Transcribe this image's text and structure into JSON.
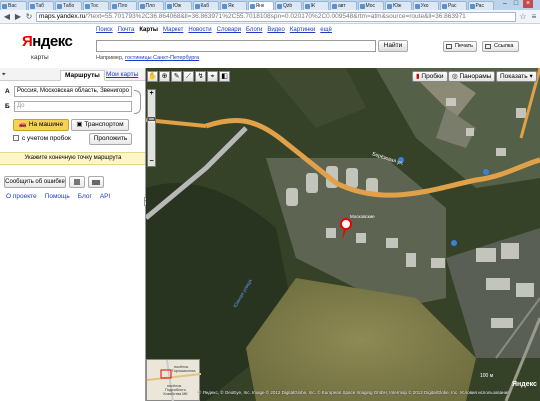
{
  "browser": {
    "tabs": [
      {
        "label": "Вас"
      },
      {
        "label": "Таб"
      },
      {
        "label": "Табо"
      },
      {
        "label": "Тос"
      },
      {
        "label": "Пло"
      },
      {
        "label": "Пло"
      },
      {
        "label": "Юж"
      },
      {
        "label": "Каб"
      },
      {
        "label": "Як"
      },
      {
        "label": "Янк"
      },
      {
        "label": "Qzb"
      },
      {
        "label": "Ж"
      },
      {
        "label": "авт"
      },
      {
        "label": "Мос"
      },
      {
        "label": "Юж"
      },
      {
        "label": "Уко"
      },
      {
        "label": "Рас"
      },
      {
        "label": "Рас"
      }
    ],
    "url_domain": "maps.yandex.ru",
    "url_rest": "/?text=55.701793%2C36.864068&ll=36.863971%2C55.7018108spn=0.020170%2C0.009548&rtm=atm&source=route&ll=36.863971"
  },
  "header": {
    "logo_part1": "Я",
    "logo_part2": "ндекс",
    "logo_sub": "карты",
    "nav_links": [
      "Поиск",
      "Почта",
      "Карты",
      "Маркет",
      "Новости",
      "Словари",
      "Блоги",
      "Видео",
      "Картинки",
      "ещё"
    ],
    "current_link": "Карты",
    "search_value": "",
    "find_label": "Найти",
    "example_prefix": "Например, ",
    "example_link": "гостиницы Санкт-Петербурга",
    "print_label": "Печать",
    "link_label": "Ссылка"
  },
  "sidebar": {
    "tab_routes": "Маршруты",
    "tab_mymaps": "Мои карты",
    "point_a_label": "А",
    "point_a_value": "Россия, Московская область, Звенигоро",
    "point_b_label": "Б",
    "point_b_placeholder": "До",
    "mode_car": "На машине",
    "mode_transit": "Транспортом",
    "traffic_label": "с учетом пробок",
    "layout_btn": "Проложить",
    "hint": "Укажите конечную точку маршрута",
    "report_btn": "Сообщить об ошибке",
    "footer_links": [
      "О проекте",
      "Помощь",
      "Блог",
      "API"
    ]
  },
  "map": {
    "traffic_btn": "Пробки",
    "panorama_btn": "Панорамы",
    "show_btn": "Показать",
    "road_label": "Берёзовая ул.",
    "street_label": "Южная улица",
    "building_label": "Московские",
    "minimap_label1": "посёлок",
    "minimap_label2": "Горошиьниха",
    "minimap_label3": "посёлок",
    "minimap_label4": "Подсобного",
    "minimap_label5": "Хозяйства МК",
    "scale_label": "100 м",
    "copyright": "© Яндекс, © GeoEye, Inc. Image © 2012 DigitalGlobe, Inc. © European Space Imaging GmbH, Intermap © 2012 DigitalGlobe, Inc. Условия использования",
    "logo": "Яндекс"
  }
}
